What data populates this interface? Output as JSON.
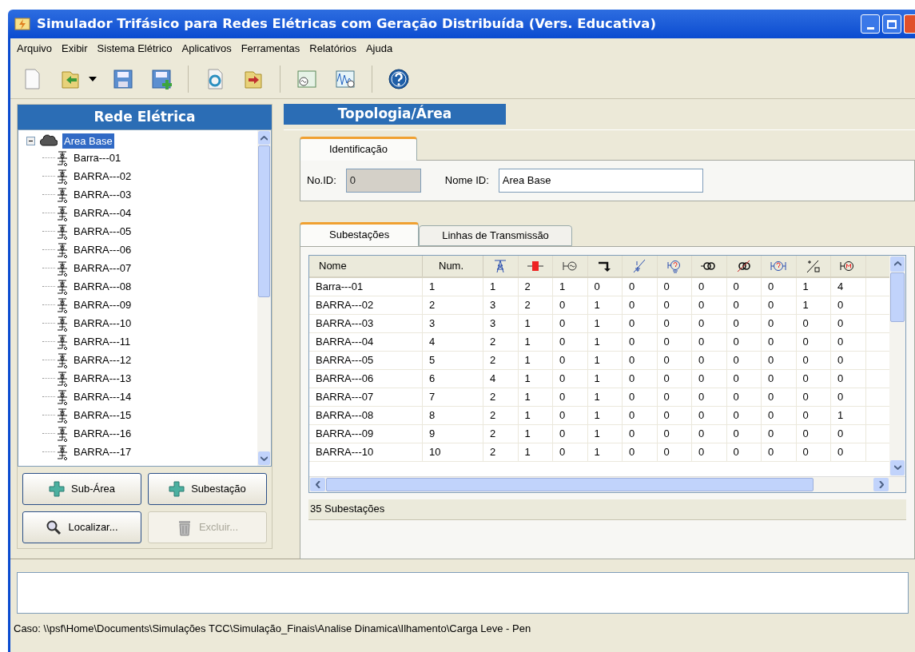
{
  "window": {
    "title": "Simulador Trifásico para Redes Elétricas com Geração Distribuída (Vers. Educativa)"
  },
  "menu": [
    "Arquivo",
    "Exibir",
    "Sistema Elétrico",
    "Aplicativos",
    "Ferramentas",
    "Relatórios",
    "Ajuda"
  ],
  "left_panel": {
    "header": "Rede Elétrica",
    "tree": {
      "label": "Area Base",
      "selected": true,
      "expanded": true,
      "children": [
        {
          "label": "Barra---01",
          "selected": false
        },
        {
          "label": "BARRA---02",
          "selected": false
        },
        {
          "label": "BARRA---03",
          "selected": false
        },
        {
          "label": "BARRA---04",
          "selected": false
        },
        {
          "label": "BARRA---05",
          "selected": false
        },
        {
          "label": "BARRA---06",
          "selected": false
        },
        {
          "label": "BARRA---07",
          "selected": false
        },
        {
          "label": "BARRA---08",
          "selected": false
        },
        {
          "label": "BARRA---09",
          "selected": false
        },
        {
          "label": "BARRA---10",
          "selected": false
        },
        {
          "label": "BARRA---11",
          "selected": false
        },
        {
          "label": "BARRA---12",
          "selected": false
        },
        {
          "label": "BARRA---13",
          "selected": false
        },
        {
          "label": "BARRA---14",
          "selected": false
        },
        {
          "label": "BARRA---15",
          "selected": false
        },
        {
          "label": "BARRA---16",
          "selected": false
        },
        {
          "label": "BARRA---17",
          "selected": false
        }
      ]
    },
    "buttons": [
      {
        "label": "Sub-Área",
        "kind": "add",
        "disabled": false
      },
      {
        "label": "Subestação",
        "kind": "add",
        "disabled": false
      },
      {
        "label": "Localizar...",
        "kind": "search",
        "disabled": false
      },
      {
        "label": "Excluir...",
        "kind": "delete",
        "disabled": true
      }
    ]
  },
  "right_panel": {
    "header": "Topologia/Área",
    "id_tabs": [
      {
        "label": "Identificação",
        "selected": true
      }
    ],
    "fields": [
      {
        "label": "No.ID:",
        "value": "0",
        "disabled": true
      },
      {
        "label": "Nome ID:",
        "value": "Area Base",
        "disabled": false
      }
    ],
    "tabs": [
      {
        "label": "Subestações",
        "selected": true
      },
      {
        "label": "Linhas de Transmissão",
        "selected": false
      }
    ],
    "table": {
      "columns": [
        "Nome",
        "Num."
      ],
      "rows": [
        [
          "Barra---01",
          "1",
          "1",
          "2",
          "1",
          "0",
          "0",
          "0",
          "0",
          "0",
          "0",
          "1",
          "4"
        ],
        [
          "BARRA---02",
          "2",
          "3",
          "2",
          "0",
          "1",
          "0",
          "0",
          "0",
          "0",
          "0",
          "1",
          "0"
        ],
        [
          "BARRA---03",
          "3",
          "3",
          "1",
          "0",
          "1",
          "0",
          "0",
          "0",
          "0",
          "0",
          "0",
          "0"
        ],
        [
          "BARRA---04",
          "4",
          "2",
          "1",
          "0",
          "1",
          "0",
          "0",
          "0",
          "0",
          "0",
          "0",
          "0"
        ],
        [
          "BARRA---05",
          "5",
          "2",
          "1",
          "0",
          "1",
          "0",
          "0",
          "0",
          "0",
          "0",
          "0",
          "0"
        ],
        [
          "BARRA---06",
          "6",
          "4",
          "1",
          "0",
          "1",
          "0",
          "0",
          "0",
          "0",
          "0",
          "0",
          "0"
        ],
        [
          "BARRA---07",
          "7",
          "2",
          "1",
          "0",
          "1",
          "0",
          "0",
          "0",
          "0",
          "0",
          "0",
          "0"
        ],
        [
          "BARRA---08",
          "8",
          "2",
          "1",
          "0",
          "1",
          "0",
          "0",
          "0",
          "0",
          "0",
          "0",
          "1"
        ],
        [
          "BARRA---09",
          "9",
          "2",
          "1",
          "0",
          "1",
          "0",
          "0",
          "0",
          "0",
          "0",
          "0",
          "0"
        ],
        [
          "BARRA---10",
          "10",
          "2",
          "1",
          "0",
          "1",
          "0",
          "0",
          "0",
          "0",
          "0",
          "0",
          "0"
        ]
      ]
    },
    "footer": "35 Subestações"
  },
  "status_bar": "Caso: \\\\psf\\Home\\Documents\\Simulações TCC\\Simulação_Finais\\Analise Dinamica\\Ilhamento\\Carga Leve - Pen"
}
